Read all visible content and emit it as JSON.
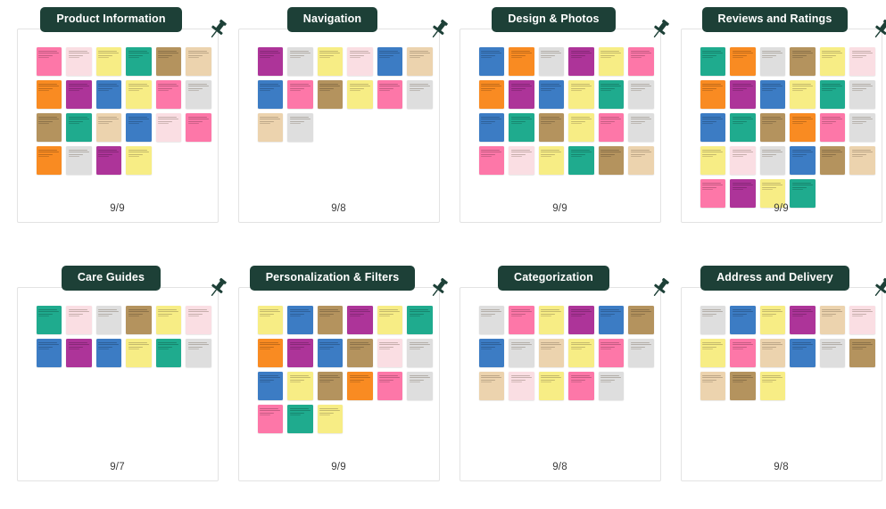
{
  "board": {
    "note_palette": {
      "pink": "#fd77a8",
      "pale_pink": "#fadee3",
      "yellow": "#f7ed85",
      "teal": "#1fab8e",
      "brown": "#b4935e",
      "tan": "#ecd3ae",
      "orange": "#f98b22",
      "purple": "#ad3499",
      "blue": "#3c7cc4",
      "gray": "#dedede"
    },
    "title_pill_color": "#1d4037",
    "title_text_color": "#ffffff",
    "card_border_color": "#e3e3e3",
    "page_background": "#ffffff",
    "pin_icon_color": "#1d4037",
    "pin_icon_name": "pushpin-icon"
  },
  "clusters": [
    {
      "title": "Product Information",
      "count": "9/9",
      "notes": [
        "pink",
        "pale_pink",
        "yellow",
        "teal",
        "brown",
        "tan",
        "orange",
        "purple",
        "blue",
        "yellow",
        "pink",
        "gray",
        "brown",
        "teal",
        "tan",
        "blue",
        "pale_pink",
        "pink",
        "orange",
        "gray",
        "purple",
        "yellow"
      ]
    },
    {
      "title": "Navigation",
      "count": "9/8",
      "notes": [
        "purple",
        "gray",
        "yellow",
        "pale_pink",
        "blue",
        "tan",
        "blue",
        "pink",
        "brown",
        "yellow",
        "pink",
        "gray",
        "tan",
        "gray"
      ]
    },
    {
      "title": "Design & Photos",
      "count": "9/9",
      "notes": [
        "blue",
        "orange",
        "gray",
        "purple",
        "yellow",
        "pink",
        "orange",
        "purple",
        "blue",
        "yellow",
        "teal",
        "gray",
        "blue",
        "teal",
        "brown",
        "yellow",
        "pink",
        "gray",
        "pink",
        "pale_pink",
        "yellow",
        "teal",
        "brown",
        "tan"
      ]
    },
    {
      "title": "Reviews and Ratings",
      "count": "9/9",
      "notes": [
        "teal",
        "orange",
        "gray",
        "brown",
        "yellow",
        "pale_pink",
        "orange",
        "purple",
        "blue",
        "yellow",
        "teal",
        "gray",
        "blue",
        "teal",
        "brown",
        "orange",
        "pink",
        "gray",
        "yellow",
        "pale_pink",
        "gray",
        "blue",
        "brown",
        "tan",
        "pink",
        "purple",
        "yellow",
        "teal"
      ]
    },
    {
      "title": "Care Guides",
      "count": "9/7",
      "notes": [
        "teal",
        "pale_pink",
        "gray",
        "brown",
        "yellow",
        "pale_pink",
        "blue",
        "purple",
        "blue",
        "yellow",
        "teal",
        "gray"
      ]
    },
    {
      "title": "Personalization & Filters",
      "count": "9/9",
      "notes": [
        "yellow",
        "blue",
        "brown",
        "purple",
        "yellow",
        "teal",
        "orange",
        "purple",
        "blue",
        "brown",
        "pale_pink",
        "gray",
        "blue",
        "yellow",
        "brown",
        "orange",
        "pink",
        "gray",
        "pink",
        "teal",
        "yellow"
      ]
    },
    {
      "title": "Categorization",
      "count": "9/8",
      "notes": [
        "gray",
        "pink",
        "yellow",
        "purple",
        "blue",
        "brown",
        "blue",
        "gray",
        "tan",
        "yellow",
        "pink",
        "gray",
        "tan",
        "pale_pink",
        "yellow",
        "pink",
        "gray"
      ]
    },
    {
      "title": "Address and Delivery",
      "count": "9/8",
      "notes": [
        "gray",
        "blue",
        "yellow",
        "purple",
        "tan",
        "pale_pink",
        "yellow",
        "pink",
        "tan",
        "blue",
        "gray",
        "brown",
        "tan",
        "brown",
        "yellow"
      ]
    }
  ]
}
